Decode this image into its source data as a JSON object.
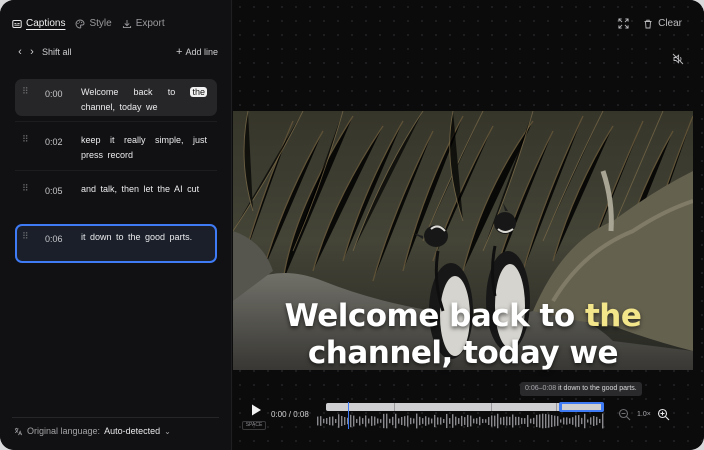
{
  "tabs": [
    {
      "label": "Captions",
      "icon": "captions-icon",
      "active": true
    },
    {
      "label": "Style",
      "icon": "palette-icon",
      "active": false
    },
    {
      "label": "Export",
      "icon": "download-icon",
      "active": false
    }
  ],
  "nav": {
    "shift_label": "Shift all",
    "add_label": "Add line"
  },
  "lines": [
    {
      "time": "0:00",
      "text_before": "Welcome back to ",
      "highlight": "the",
      "text_after": " channel, today we"
    },
    {
      "time": "0:02",
      "text": "keep it really simple, just press record"
    },
    {
      "time": "0:05",
      "text": "and talk, then let the AI cut"
    },
    {
      "time": "0:06",
      "text": "it down to the good parts."
    }
  ],
  "footer": {
    "label": "Original language:",
    "value": "Auto-detected"
  },
  "top": {
    "clear_label": "Clear"
  },
  "caption": {
    "line1_prefix": "Welcome back to ",
    "line1_active": "the",
    "line2": "channel, today we"
  },
  "player": {
    "timecode": "0:00 / 0:08",
    "space_hint": "SPACE",
    "tooltip_time": "0:06–0:08",
    "tooltip_text": "it down to the good parts.",
    "zoom": "1.0×"
  },
  "colors": {
    "accent": "#3f7bf5",
    "active_caption": "#f2e58a"
  }
}
